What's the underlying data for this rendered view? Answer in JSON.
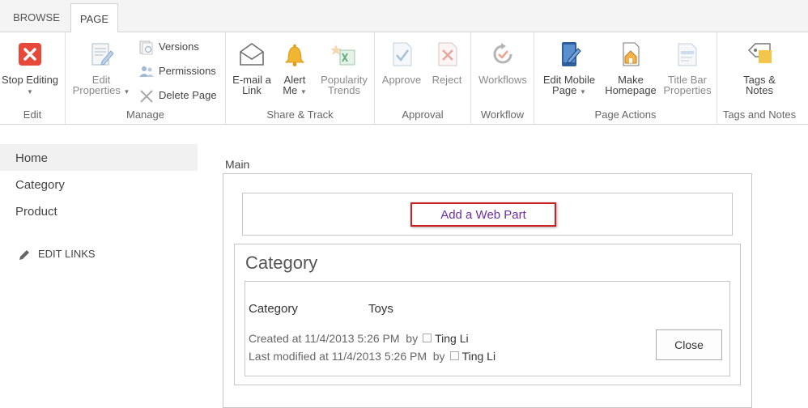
{
  "tabs": {
    "browse": "BROWSE",
    "page": "PAGE"
  },
  "ribbon": {
    "edit": {
      "stop_editing": "Stop Editing",
      "group": "Edit"
    },
    "manage": {
      "edit_properties_1": "Edit",
      "edit_properties_2": "Properties",
      "versions": "Versions",
      "permissions": "Permissions",
      "delete_page": "Delete Page",
      "group": "Manage"
    },
    "share": {
      "email_1": "E-mail a",
      "email_2": "Link",
      "alert_1": "Alert",
      "alert_2": "Me",
      "popularity_1": "Popularity",
      "popularity_2": "Trends",
      "group": "Share & Track"
    },
    "approval": {
      "approve": "Approve",
      "reject": "Reject",
      "group": "Approval"
    },
    "workflow": {
      "workflows": "Workflows",
      "group": "Workflow"
    },
    "page_actions": {
      "edit_mobile_1": "Edit Mobile",
      "edit_mobile_2": "Page",
      "make_home_1": "Make",
      "make_home_2": "Homepage",
      "title_bar_1": "Title Bar",
      "title_bar_2": "Properties",
      "group": "Page Actions"
    },
    "tags": {
      "tags_1": "Tags &",
      "tags_2": "Notes",
      "group": "Tags and Notes"
    }
  },
  "leftnav": {
    "items": [
      {
        "label": "Home"
      },
      {
        "label": "Category"
      },
      {
        "label": "Product"
      }
    ],
    "edit_links": "EDIT LINKS"
  },
  "main": {
    "zone_title": "Main",
    "add_web_part": "Add a Web Part",
    "webpart": {
      "title": "Category",
      "field_label": "Category",
      "field_value": "Toys",
      "created_text": "Created at 11/4/2013 5:26 PM  by",
      "created_user": "Ting Li",
      "modified_text": "Last modified at 11/4/2013 5:26 PM  by",
      "modified_user": "Ting Li",
      "close": "Close"
    }
  },
  "colors": {
    "stop_editing_red": "#e8483a",
    "highlight_border": "#cc1f1f",
    "link_purple": "#6b2fa1"
  }
}
